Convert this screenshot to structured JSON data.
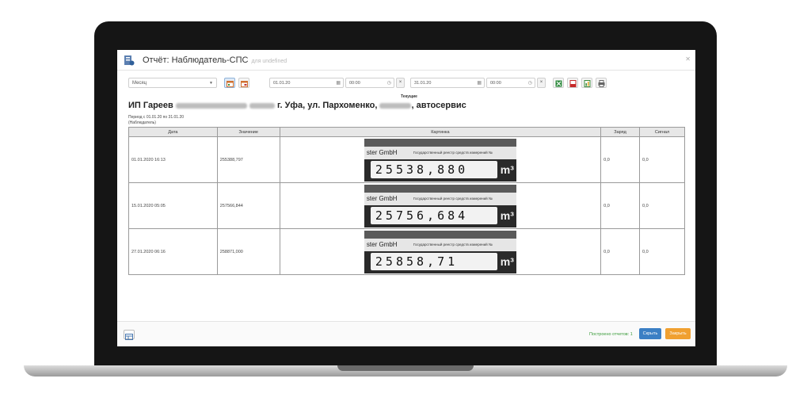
{
  "window": {
    "title": "Отчёт: Наблюдатель-СПС",
    "subtitle": "для undefined"
  },
  "toolbar": {
    "period_select": "Месяц",
    "start_date": "01.01.20",
    "start_time": "00:00",
    "end_date": "31.01.20",
    "end_time": "00:00",
    "clear_label": "×"
  },
  "report": {
    "label_current": "Текущие",
    "heading_prefix": "ИП Гареев",
    "heading_city": "г. Уфа, ул. Пархоменко,",
    "heading_suffix": ", автосервис",
    "period": "Период с 01.01.20 по 31.01.20",
    "observer": "(Наблюдатель)",
    "columns": [
      "Дата",
      "Значение",
      "Картинка",
      "Заряд",
      "Сигнал"
    ],
    "rows": [
      {
        "date": "01.01.2020 16:13",
        "value": "255388,797",
        "charge": "0,0",
        "signal": "0,0",
        "meter_digits": "25538,880",
        "meter_brand": "ster GmbH",
        "meter_desc": "Государственный реестр средств измерений №"
      },
      {
        "date": "15.01.2020 05:05",
        "value": "257566,844",
        "charge": "0,0",
        "signal": "0,0",
        "meter_digits": "25756,684",
        "meter_brand": "ster GmbH",
        "meter_desc": "Государственный реестр средств измерений №"
      },
      {
        "date": "27.01.2020 06:16",
        "value": "258871,000",
        "charge": "0,0",
        "signal": "0,0",
        "meter_digits": "25858,71",
        "meter_brand": "ster GmbH",
        "meter_desc": "Государственный реестр средств измерений №"
      }
    ],
    "meter_unit": "m³"
  },
  "footer": {
    "built_label": "Построено отчетов: 1",
    "hide_label": "Скрыть",
    "close_label": "Закрыть"
  },
  "icons": [
    "report-icon",
    "calendar-icon",
    "clock-icon",
    "excel-icon",
    "pdf-icon",
    "print-icon",
    "layout-icon"
  ]
}
